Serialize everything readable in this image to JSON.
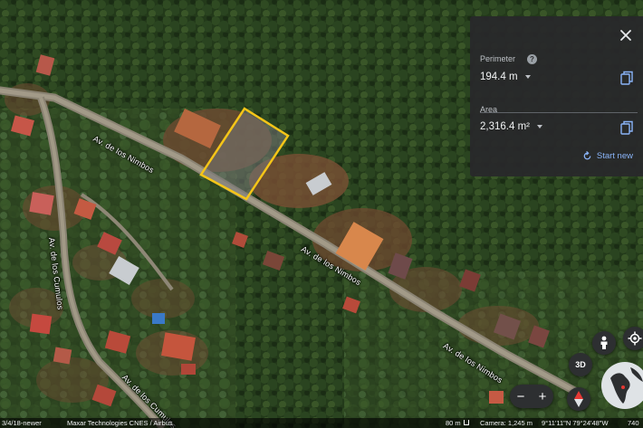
{
  "map": {
    "roads": {
      "nimbos_upper": "Av. de los Nimbos",
      "nimbos_mid": "Av. de los Nimbos",
      "nimbos_lower": "Av. de los Nimbos",
      "cumulos_left": "Av. de los Cumulos",
      "cumulos_bottom": "Av. de los Cumulos"
    }
  },
  "measure_panel": {
    "perimeter_label": "Perimeter",
    "perimeter_value": "194.4 m",
    "area_label": "Area",
    "area_value": "2,316.4 m²",
    "start_new_label": "Start new"
  },
  "controls": {
    "three_d_label": "3D",
    "zoom_out": "−",
    "zoom_in": "+"
  },
  "status_bar": {
    "imagery_date": "3/4/18-newer",
    "attribution": "Maxar Technologies   CNES / Airbus",
    "scale": "80 m",
    "camera": "Camera: 1,245 m",
    "coords": "9°11'11\"N 79°24'48\"W",
    "elevation": "740"
  },
  "colors": {
    "measure_outline": "#f5c518",
    "link_blue": "#8ab4f8",
    "panel_bg": "#28282a"
  }
}
